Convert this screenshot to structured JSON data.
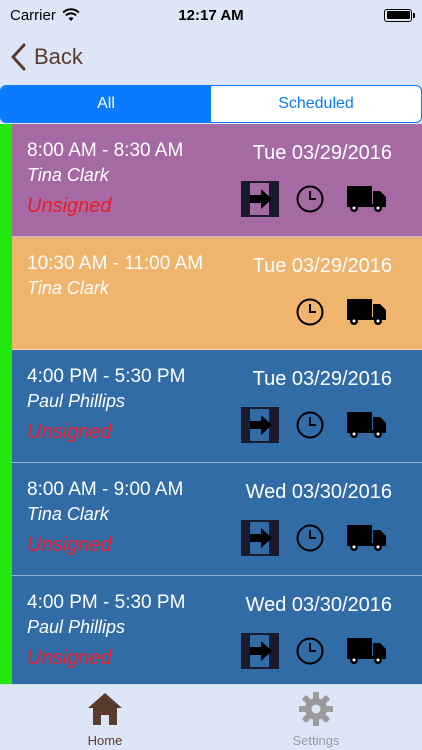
{
  "status_bar": {
    "carrier": "Carrier",
    "time": "12:17 AM"
  },
  "nav": {
    "back_label": "Back"
  },
  "tabs": [
    {
      "label": "All",
      "active": true
    },
    {
      "label": "Scheduled",
      "active": false
    }
  ],
  "appointments": [
    {
      "time": "8:00 AM - 8:30 AM",
      "name": "Tina Clark",
      "status": "Unsigned",
      "date": "Tue 03/29/2016",
      "color": "#a56aa3",
      "icons": [
        "sign-in-icon",
        "clock-icon",
        "truck-icon"
      ]
    },
    {
      "time": "10:30 AM - 11:00 AM",
      "name": "Tina Clark",
      "status": "",
      "date": "Tue 03/29/2016",
      "color": "#efb46e",
      "icons": [
        "clock-icon",
        "truck-icon"
      ]
    },
    {
      "time": "4:00 PM - 5:30 PM",
      "name": "Paul Phillips",
      "status": "Unsigned",
      "date": "Tue 03/29/2016",
      "color": "#316ca6",
      "icons": [
        "sign-in-icon",
        "clock-icon",
        "truck-icon"
      ]
    },
    {
      "time": "8:00 AM - 9:00 AM",
      "name": "Tina Clark",
      "status": "Unsigned",
      "date": "Wed 03/30/2016",
      "color": "#316ca6",
      "icons": [
        "sign-in-icon",
        "clock-icon",
        "truck-icon"
      ]
    },
    {
      "time": "4:00 PM - 5:30 PM",
      "name": "Paul Phillips",
      "status": "Unsigned",
      "date": "Wed 03/30/2016",
      "color": "#316ca6",
      "icons": [
        "sign-in-icon",
        "clock-icon",
        "truck-icon"
      ]
    }
  ],
  "tab_bar": [
    {
      "label": "Home",
      "icon": "home-icon",
      "active": true,
      "color": "#5b3a2e"
    },
    {
      "label": "Settings",
      "icon": "gear-icon",
      "active": false,
      "color": "#9b9b9b"
    }
  ]
}
